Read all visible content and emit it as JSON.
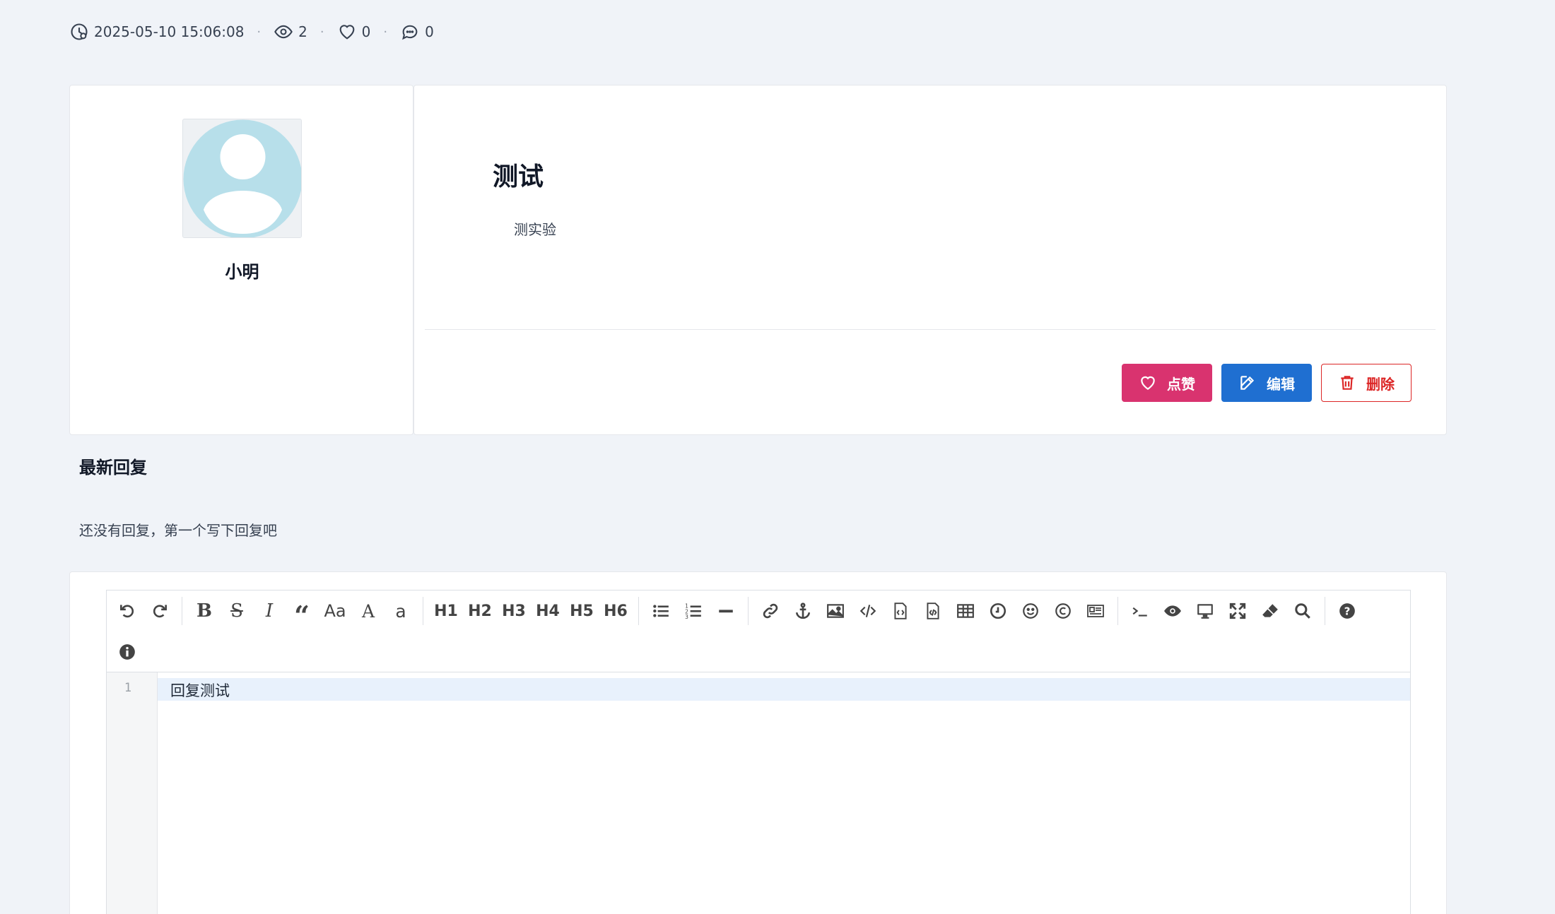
{
  "meta": {
    "datetime": "2025-05-10 15:06:08",
    "views": "2",
    "likes": "0",
    "comments": "0",
    "separator": "·"
  },
  "author": {
    "name": "小明",
    "avatar_icon": "user-avatar-icon"
  },
  "post": {
    "title": "测试",
    "body": "测实验"
  },
  "actions": {
    "like_label": "点赞",
    "edit_label": "编辑",
    "delete_label": "删除"
  },
  "replies": {
    "title": "最新回复",
    "empty_text": "还没有回复，第一个写下回复吧"
  },
  "editor": {
    "line_number": "1",
    "content": "回复测试",
    "toolbar_headings": [
      "H1",
      "H2",
      "H3",
      "H4",
      "H5",
      "H6"
    ],
    "case_upper": "Aa",
    "case_a": "A",
    "case_lower": "a"
  },
  "colors": {
    "like": "#d9336f",
    "edit": "#1f6fd1",
    "delete": "#dc2626",
    "background": "#f0f3f8"
  }
}
